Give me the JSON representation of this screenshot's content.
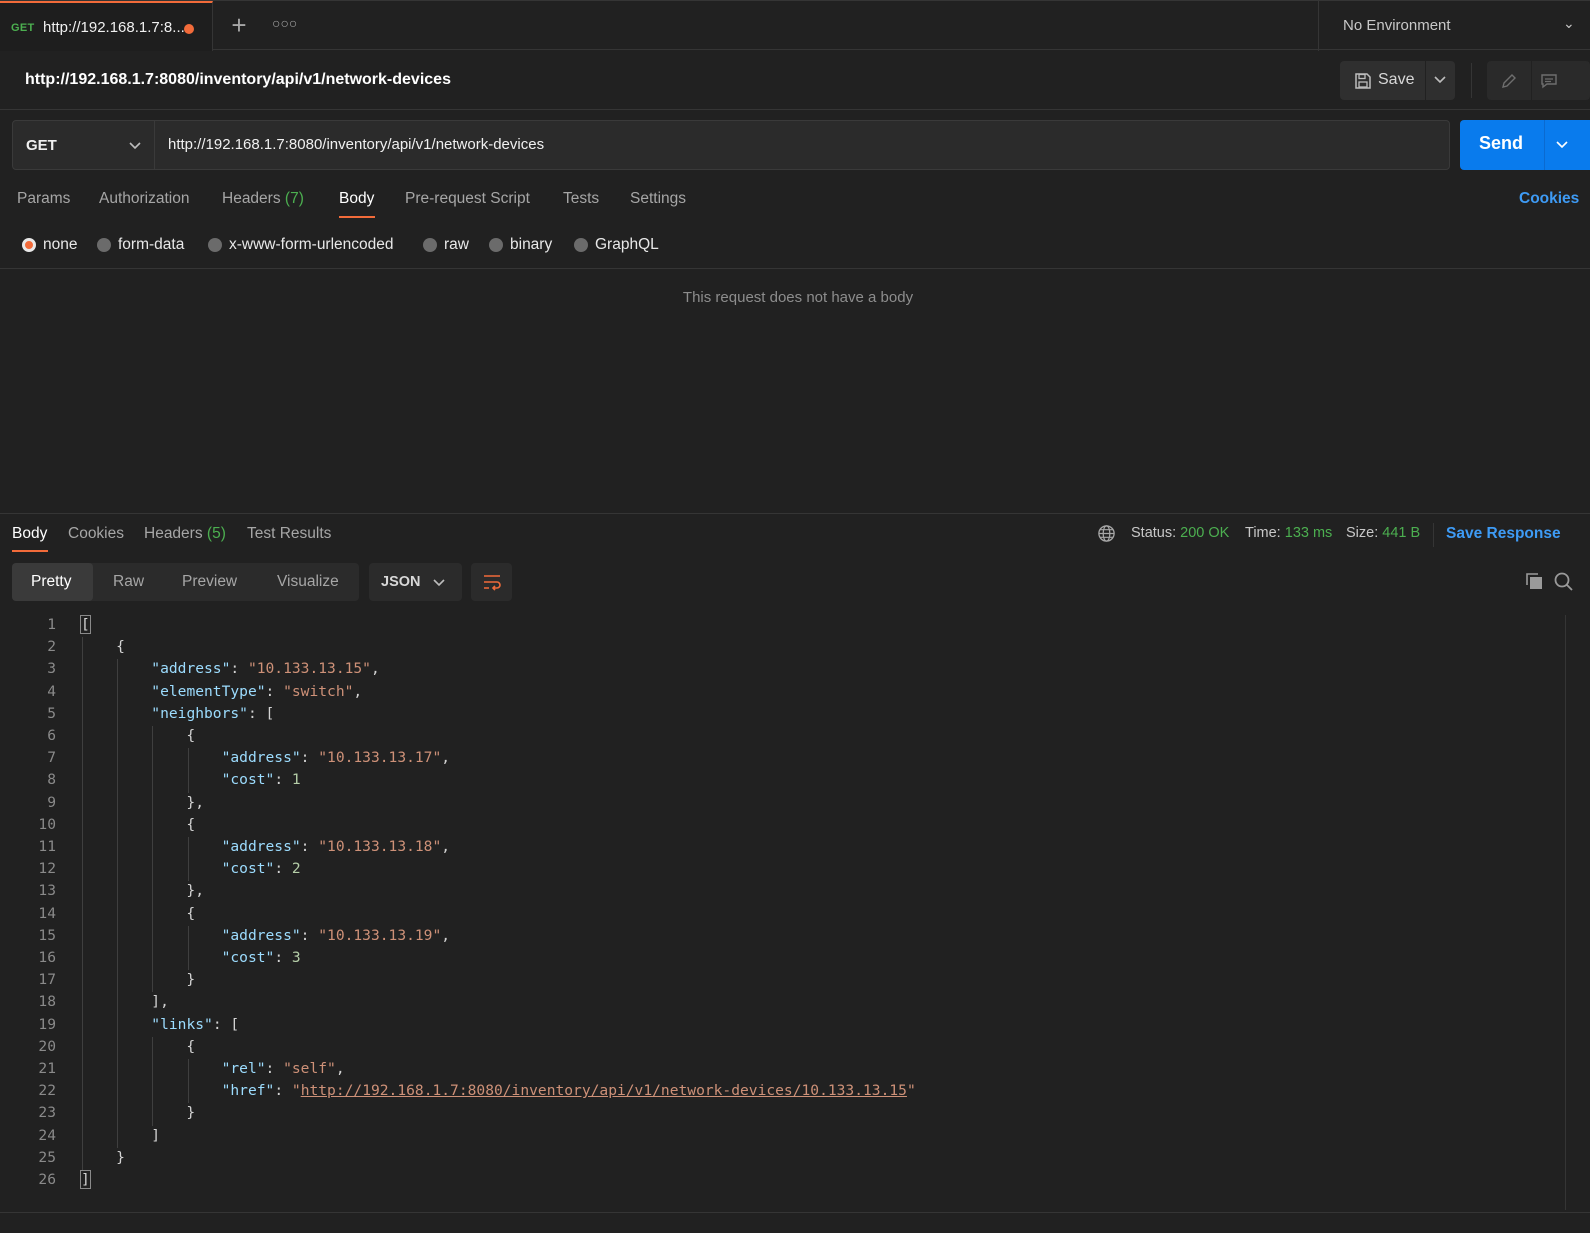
{
  "tab": {
    "method": "GET",
    "title": "http://192.168.1.7:8..."
  },
  "environment": {
    "label": "No Environment"
  },
  "request": {
    "name": "http://192.168.1.7:8080/inventory/api/v1/network-devices",
    "method": "GET",
    "url": "http://192.168.1.7:8080/inventory/api/v1/network-devices",
    "save_label": "Save",
    "send_label": "Send"
  },
  "req_tabs": {
    "params": "Params",
    "authorization": "Authorization",
    "headers": "Headers",
    "headers_count": "(7)",
    "body": "Body",
    "prerequest": "Pre-request Script",
    "tests": "Tests",
    "settings": "Settings",
    "cookies": "Cookies"
  },
  "body_modes": [
    "none",
    "form-data",
    "x-www-form-urlencoded",
    "raw",
    "binary",
    "GraphQL"
  ],
  "body_mode_selected": "none",
  "no_body_message": "This request does not have a body",
  "response": {
    "tabs": {
      "body": "Body",
      "cookies": "Cookies",
      "headers": "Headers",
      "headers_count": "(5)",
      "test_results": "Test Results"
    },
    "status_label": "Status:",
    "status": "200 OK",
    "time_label": "Time:",
    "time": "133 ms",
    "size_label": "Size:",
    "size": "441 B",
    "save_response": "Save Response",
    "views": [
      "Pretty",
      "Raw",
      "Preview",
      "Visualize"
    ],
    "format": "JSON",
    "lines": [
      "[",
      "    {",
      "        \"address\": \"10.133.13.15\",",
      "        \"elementType\": \"switch\",",
      "        \"neighbors\": [",
      "            {",
      "                \"address\": \"10.133.13.17\",",
      "                \"cost\": 1",
      "            },",
      "            {",
      "                \"address\": \"10.133.13.18\",",
      "                \"cost\": 2",
      "            },",
      "            {",
      "                \"address\": \"10.133.13.19\",",
      "                \"cost\": 3",
      "            }",
      "        ],",
      "        \"links\": [",
      "            {",
      "                \"rel\": \"self\",",
      "                \"href\": \"http://192.168.1.7:8080/inventory/api/v1/network-devices/10.133.13.15\"",
      "            }",
      "        ]",
      "    }",
      "]"
    ]
  },
  "colors": {
    "accent": "#f26b3a",
    "send": "#097bed",
    "success": "#4caf50",
    "link": "#3e9bf5"
  }
}
